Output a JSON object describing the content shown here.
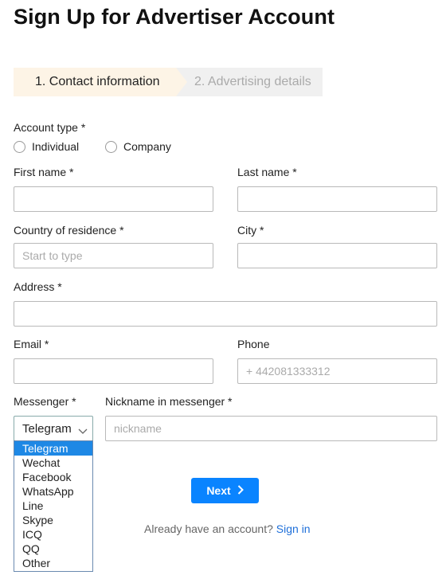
{
  "title": "Sign Up for Advertiser Account",
  "steps": [
    {
      "label": "1. Contact information"
    },
    {
      "label": "2. Advertising details"
    }
  ],
  "account_type": {
    "label": "Account type *",
    "options": [
      "Individual",
      "Company"
    ]
  },
  "first_name": {
    "label": "First name *",
    "value": "",
    "placeholder": ""
  },
  "last_name": {
    "label": "Last name *",
    "value": "",
    "placeholder": ""
  },
  "country": {
    "label": "Country of residence *",
    "placeholder": "Start to type"
  },
  "city": {
    "label": "City *",
    "placeholder": ""
  },
  "address": {
    "label": "Address *",
    "placeholder": ""
  },
  "email": {
    "label": "Email *",
    "placeholder": ""
  },
  "phone": {
    "label": "Phone",
    "placeholder": "+ 442081333312"
  },
  "messenger": {
    "label": "Messenger *",
    "selected": "Telegram",
    "options": [
      "Telegram",
      "Wechat",
      "Facebook",
      "WhatsApp",
      "Line",
      "Skype",
      "ICQ",
      "QQ",
      "Other"
    ]
  },
  "nickname": {
    "label": "Nickname in messenger *",
    "placeholder": "nickname"
  },
  "next_button": {
    "label": "Next"
  },
  "signin": {
    "prefix": "Already have an account?",
    "link": "Sign in"
  }
}
